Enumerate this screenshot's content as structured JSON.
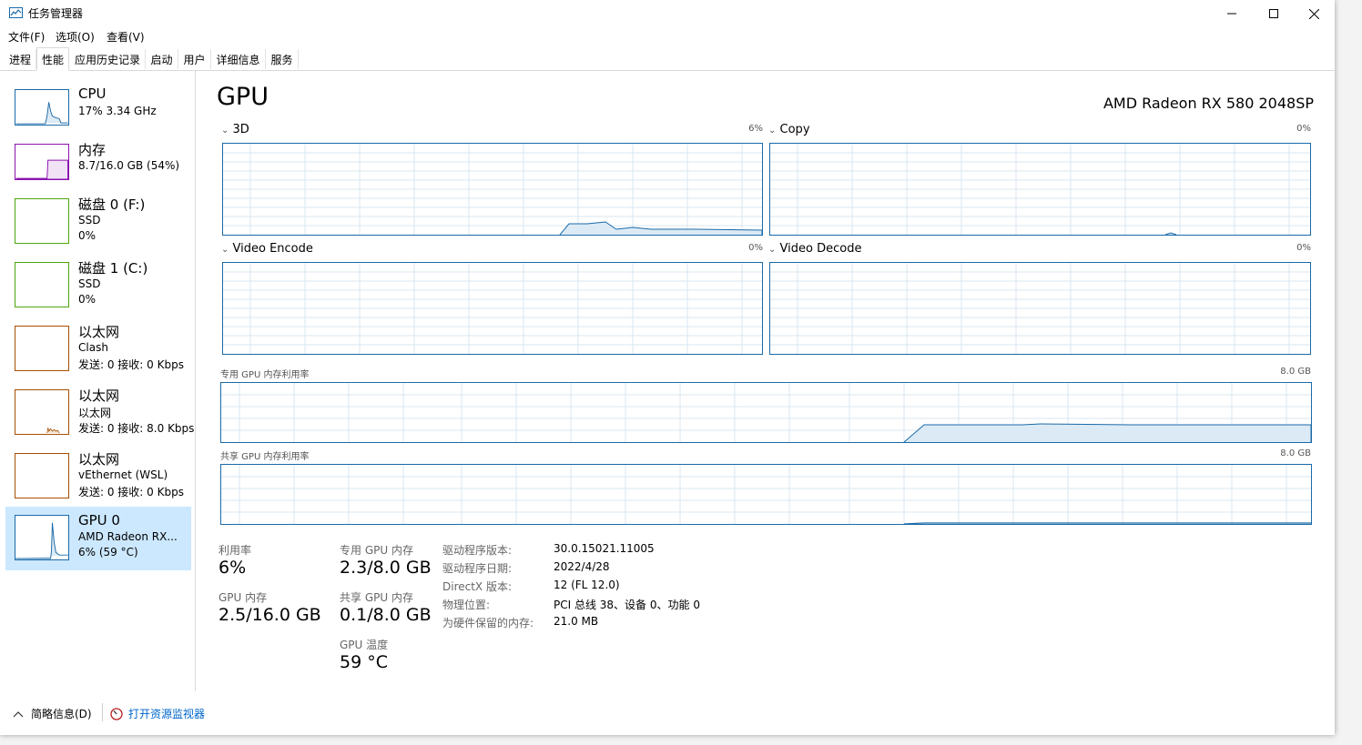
{
  "window": {
    "title": "任务管理器"
  },
  "menu": [
    "文件(F)",
    "选项(O)",
    "查看(V)"
  ],
  "tabs": [
    "进程",
    "性能",
    "应用历史记录",
    "启动",
    "用户",
    "详细信息",
    "服务"
  ],
  "active_tab": 1,
  "sidebar": [
    {
      "name": "CPU",
      "line2": "17%  3.34 GHz",
      "line3": "",
      "color": "#1a6aa8"
    },
    {
      "name": "内存",
      "line2": "8.7/16.0 GB (54%)",
      "line3": "",
      "color": "#8b12ae"
    },
    {
      "name": "磁盘 0 (F:)",
      "line2": "SSD",
      "line3": "0%",
      "color": "#4da60c"
    },
    {
      "name": "磁盘 1 (C:)",
      "line2": "SSD",
      "line3": "0%",
      "color": "#4da60c"
    },
    {
      "name": "以太网",
      "line2": "Clash",
      "line3": "发送: 0  接收: 0 Kbps",
      "color": "#a74f01"
    },
    {
      "name": "以太网",
      "line2": "以太网",
      "line3": "发送: 0  接收: 8.0 Kbps",
      "color": "#a74f01"
    },
    {
      "name": "以太网",
      "line2": "vEthernet (WSL)",
      "line3": "发送: 0  接收: 0 Kbps",
      "color": "#a74f01"
    },
    {
      "name": "GPU 0",
      "line2": "AMD Radeon RX...",
      "line3": "6% (59 °C)",
      "color": "#1a6aa8"
    }
  ],
  "gpu": {
    "title": "GPU",
    "model": "AMD Radeon RX 580 2048SP",
    "engines": [
      {
        "name": "3D",
        "pct": "6%"
      },
      {
        "name": "Copy",
        "pct": "0%"
      },
      {
        "name": "Video Encode",
        "pct": "0%"
      },
      {
        "name": "Video Decode",
        "pct": "0%"
      }
    ],
    "dedicated": {
      "label": "专用 GPU 内存利用率",
      "max": "8.0 GB"
    },
    "shared": {
      "label": "共享 GPU 内存利用率",
      "max": "8.0 GB"
    },
    "stats": {
      "util_label": "利用率",
      "util_val": "6%",
      "ded_label": "专用 GPU 内存",
      "ded_val": "2.3/8.0 GB",
      "mem_label": "GPU 内存",
      "mem_val": "2.5/16.0 GB",
      "shr_label": "共享 GPU 内存",
      "shr_val": "0.1/8.0 GB",
      "temp_label": "GPU 温度",
      "temp_val": "59 °C"
    },
    "info": [
      {
        "label": "驱动程序版本:",
        "value": "30.0.15021.11005"
      },
      {
        "label": "驱动程序日期:",
        "value": "2022/4/28"
      },
      {
        "label": "DirectX 版本:",
        "value": "12 (FL 12.0)"
      },
      {
        "label": "物理位置:",
        "value": "PCI 总线 38、设备 0、功能 0"
      },
      {
        "label": "为硬件保留的内存:",
        "value": "21.0 MB"
      }
    ]
  },
  "footer": {
    "summary": "简略信息(D)",
    "monitor": "打开资源监视器"
  },
  "colors": {
    "accent": "#1a6aa8",
    "selected_bg": "#cce8ff",
    "link": "#0066cc"
  }
}
